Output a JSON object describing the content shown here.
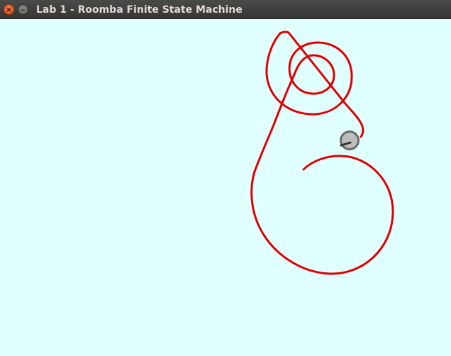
{
  "window": {
    "title": "Lab 1 - Roomba Finite State Machine",
    "close_icon": "close-icon",
    "minimize_icon": "minimize-icon",
    "close_glyph": "×",
    "minimize_glyph": "–"
  },
  "colors": {
    "background": "#e0ffff",
    "trail": "#e00000",
    "robot_body": "#bdbdbd",
    "robot_outline": "#6a6a6a",
    "robot_heading": "#333333"
  }
}
